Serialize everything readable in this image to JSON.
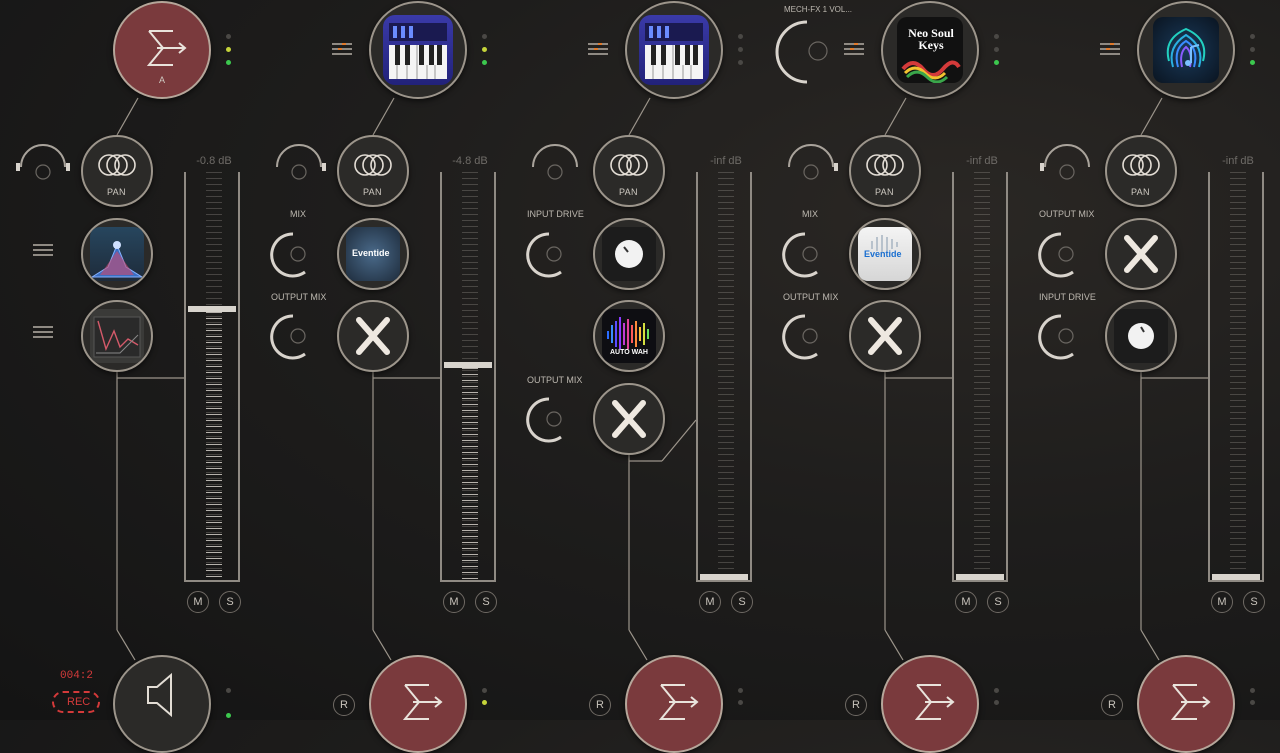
{
  "channels": [
    {
      "top": {
        "type": "sum",
        "label": "A"
      },
      "pan_label": "PAN",
      "db": "-0.8 dB",
      "fader_level": 0.67,
      "slots": [
        {
          "knob_label": "",
          "icon": "eq-icon"
        },
        {
          "knob_label": "",
          "icon": "analyzer-icon"
        }
      ],
      "mute": "M",
      "solo": "S",
      "bottom": {
        "type": "speaker"
      }
    },
    {
      "top": {
        "type": "synth"
      },
      "pan_label": "PAN",
      "db": "-4.8 dB",
      "fader_level": 0.53,
      "slots": [
        {
          "knob_label": "MIX",
          "icon": "eventide-icon"
        },
        {
          "knob_label": "OUTPUT MIX",
          "icon": "x-plugin-icon"
        }
      ],
      "mute": "M",
      "solo": "S",
      "bottom": {
        "type": "sum",
        "r": "R"
      }
    },
    {
      "top": {
        "type": "synth"
      },
      "pan_label": "PAN",
      "db": "-inf dB",
      "fader_level": 0.0,
      "slots": [
        {
          "knob_label": "INPUT DRIVE",
          "icon": "drive-knob-icon"
        },
        {
          "knob_label": "",
          "icon": "auto-wah-icon",
          "text": "AUTO WAH"
        },
        {
          "knob_label": "OUTPUT MIX",
          "icon": "x-plugin-icon"
        }
      ],
      "mute": "M",
      "solo": "S",
      "bottom": {
        "type": "sum",
        "r": "R"
      }
    },
    {
      "top": {
        "type": "neo-soul",
        "knob_label": "MECH-FX 1 VOL...",
        "logo_text": "Neo Soul Keys"
      },
      "pan_label": "PAN",
      "db": "-inf dB",
      "fader_level": 0.0,
      "slots": [
        {
          "knob_label": "MIX",
          "icon": "eventide-icon"
        },
        {
          "knob_label": "OUTPUT MIX",
          "icon": "x-plugin-icon"
        }
      ],
      "mute": "M",
      "solo": "S",
      "bottom": {
        "type": "sum",
        "r": "R"
      }
    },
    {
      "top": {
        "type": "fingerprint"
      },
      "pan_label": "PAN",
      "db": "-inf dB",
      "fader_level": 0.0,
      "slots": [
        {
          "knob_label": "OUTPUT MIX",
          "icon": "x-plugin-icon"
        },
        {
          "knob_label": "INPUT DRIVE",
          "icon": "drive-knob-icon"
        }
      ],
      "mute": "M",
      "solo": "S",
      "bottom": {
        "type": "sum",
        "r": "R"
      }
    }
  ],
  "eventide_text": "Eventide",
  "recorder": {
    "time": "004:2",
    "label": "REC"
  },
  "colors": {
    "accent_red": "#7a3a3d",
    "rec_red": "#d43a3a",
    "led_green": "#3cc84e"
  }
}
